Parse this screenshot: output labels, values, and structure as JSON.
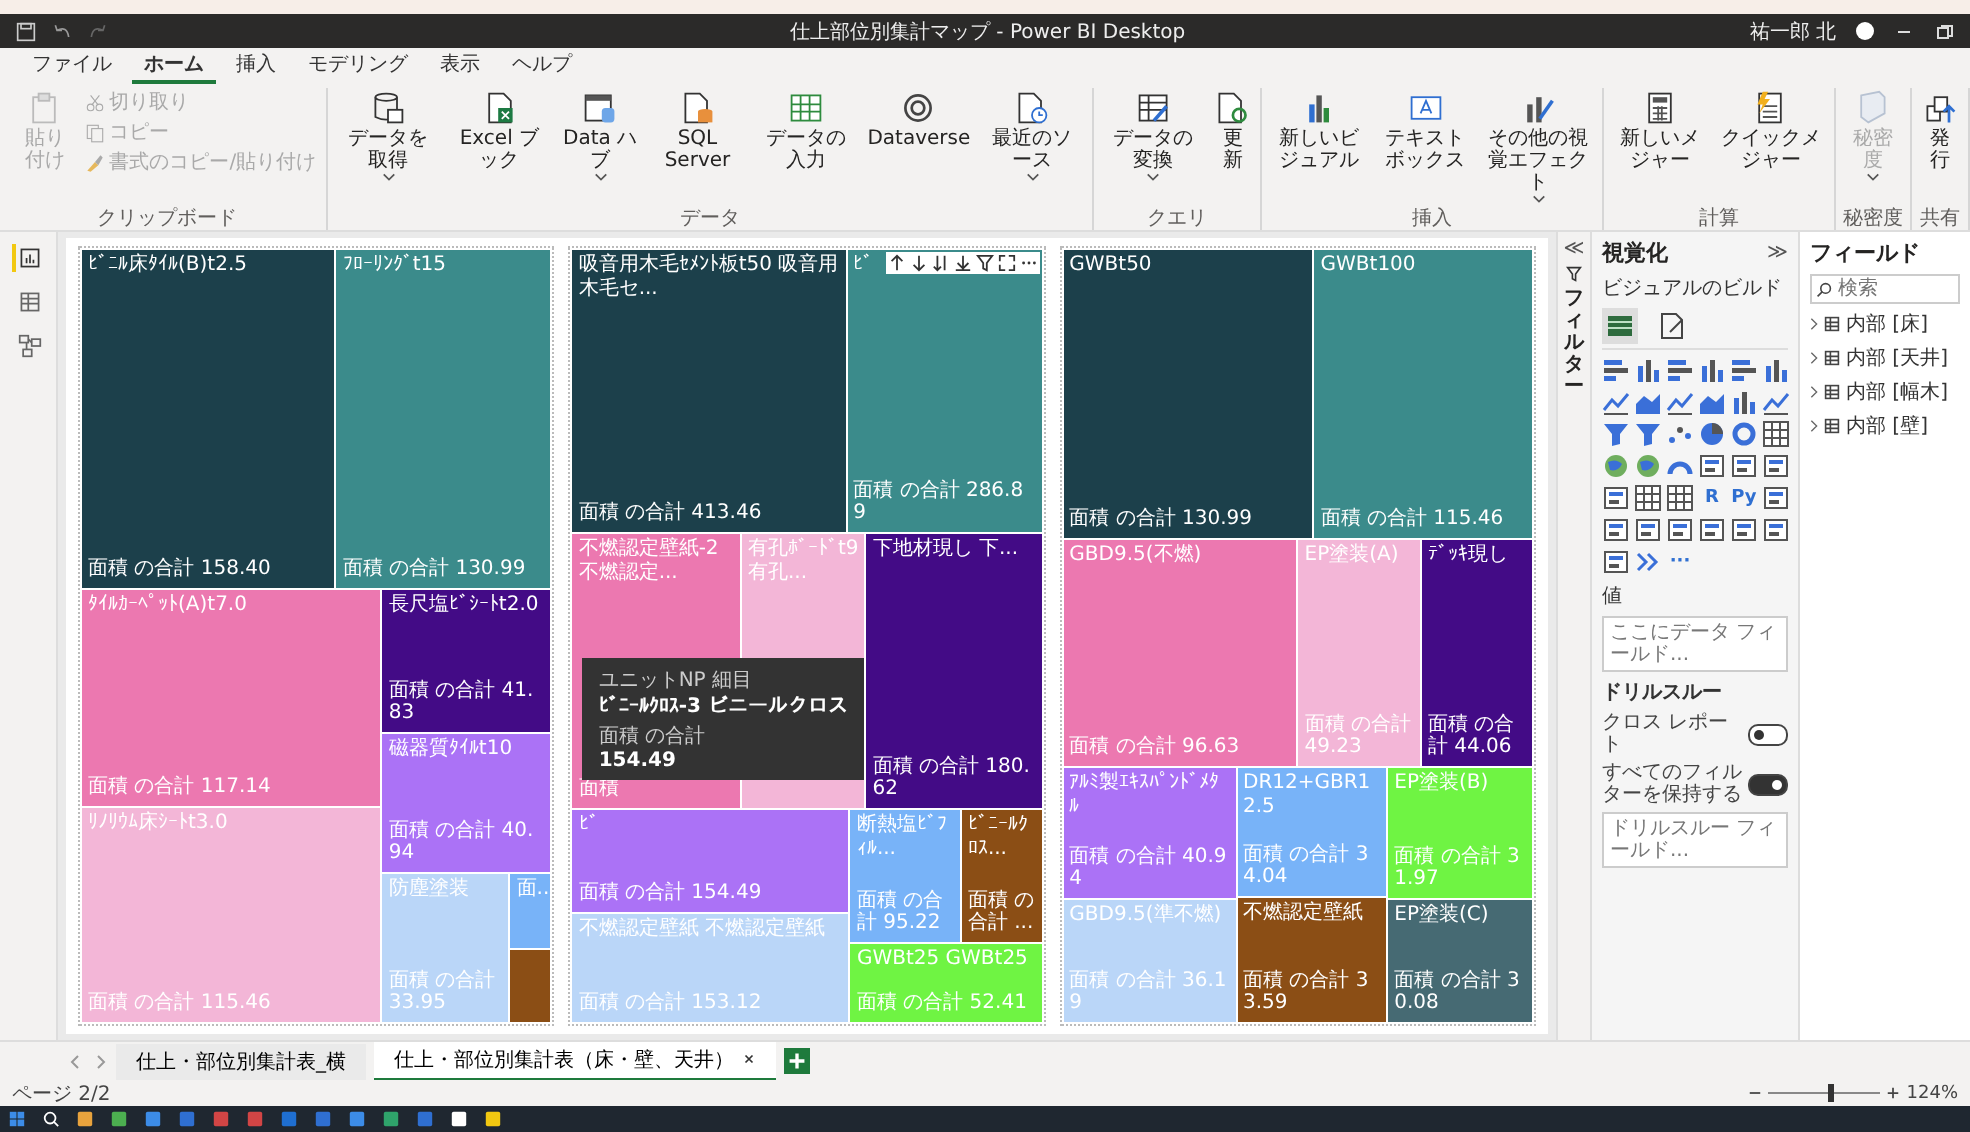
{
  "title_bar": {
    "title": "仕上部位別集計マップ - Power BI Desktop",
    "user": "祐一郎 北"
  },
  "menu_tabs": [
    {
      "label": "ファイル",
      "selected": false
    },
    {
      "label": "ホーム",
      "selected": true
    },
    {
      "label": "挿入",
      "selected": false
    },
    {
      "label": "モデリング",
      "selected": false
    },
    {
      "label": "表示",
      "selected": false
    },
    {
      "label": "ヘルプ",
      "selected": false
    }
  ],
  "ribbon": {
    "groups": [
      {
        "label": "クリップボード",
        "buttons": [
          {
            "kind": "large",
            "label": "貼り付け",
            "disabled": true,
            "dropdown": false
          },
          {
            "kind": "small",
            "label": "切り取り",
            "disabled": true
          },
          {
            "kind": "small",
            "label": "コピー",
            "disabled": true
          },
          {
            "kind": "small",
            "label": "書式のコピー/貼り付け",
            "disabled": true
          }
        ]
      },
      {
        "label": "データ",
        "buttons": [
          {
            "kind": "large",
            "label": "データを取得",
            "disabled": false,
            "dropdown": true
          },
          {
            "kind": "large",
            "label": "Excel ブック",
            "disabled": false,
            "dropdown": false
          },
          {
            "kind": "large",
            "label": "Data ハブ",
            "disabled": false,
            "dropdown": true
          },
          {
            "kind": "large",
            "label": "SQL Server",
            "disabled": false,
            "dropdown": false
          },
          {
            "kind": "large",
            "label": "データの入力",
            "disabled": false,
            "dropdown": false
          },
          {
            "kind": "large",
            "label": "Dataverse",
            "disabled": false,
            "dropdown": false
          },
          {
            "kind": "large",
            "label": "最近のソース",
            "disabled": false,
            "dropdown": true
          }
        ]
      },
      {
        "label": "クエリ",
        "buttons": [
          {
            "kind": "large",
            "label": "データの変換",
            "disabled": false,
            "dropdown": true
          },
          {
            "kind": "large",
            "label": "更新",
            "disabled": false,
            "dropdown": false
          }
        ]
      },
      {
        "label": "挿入",
        "buttons": [
          {
            "kind": "large",
            "label": "新しいビジュアル",
            "disabled": false,
            "dropdown": false
          },
          {
            "kind": "large",
            "label": "テキストボックス",
            "disabled": false,
            "dropdown": false
          },
          {
            "kind": "large",
            "label": "その他の視覚エフェクト",
            "disabled": false,
            "dropdown": true
          }
        ]
      },
      {
        "label": "計算",
        "buttons": [
          {
            "kind": "large",
            "label": "新しいメジャー",
            "disabled": false,
            "dropdown": false
          },
          {
            "kind": "large",
            "label": "クイックメジャー",
            "disabled": false,
            "dropdown": false
          }
        ]
      },
      {
        "label": "秘密度",
        "buttons": [
          {
            "kind": "large",
            "label": "秘密度",
            "disabled": true,
            "dropdown": true
          }
        ]
      },
      {
        "label": "共有",
        "buttons": [
          {
            "kind": "large",
            "label": "発行",
            "disabled": false,
            "dropdown": false
          }
        ]
      }
    ]
  },
  "left_nav": [
    {
      "selected": true
    },
    {
      "selected": false
    },
    {
      "selected": false
    }
  ],
  "visuals": [
    {
      "tiles": [
        {
          "label": "ﾋﾞﾆﾙ床ﾀｲﾙ(B)t2.5",
          "total": "面積 の合計 158.40",
          "color": "#1c404b"
        },
        {
          "label": "ﾌﾛｰﾘﾝｸﾞt15",
          "total": "面積 の合計 130.99",
          "color": "#3b8b8b"
        },
        {
          "label": "ﾀｲﾙｶｰﾍﾟｯﾄ(A)t7.0",
          "total": "面積 の合計 117.14",
          "color": "#ec78b0"
        },
        {
          "label": "ﾘﾉﾘｳﾑ床ｼｰﾄt3.0",
          "total": "面積 の合計 115.46",
          "color": "#f3b6d7"
        },
        {
          "label": "長尺塩ﾋﾞｼｰﾄt2.0",
          "total": "面積 の合計 41.83",
          "color": "#430b86"
        },
        {
          "label": "磁器質ﾀｲﾙt10",
          "total": "面積 の合計 40.94",
          "color": "#ab72f6"
        },
        {
          "label": "防塵塗装",
          "total": "面積 の合計 33.95",
          "color": "#bad6f8"
        },
        {
          "total": "面...",
          "color": "#78b3f8"
        },
        {
          "color": "#8b4e15"
        }
      ]
    },
    {
      "header": true,
      "tiles": [
        {
          "label": "吸音用木毛ｾﾒﾝﾄ板t50 吸音用木毛セ...",
          "total": "面積 の合計 413.46",
          "color": "#1c404b"
        },
        {
          "label": "ﾋﾞ",
          "total": "面積 の合計 286.89",
          "color": "#3b8b8b"
        },
        {
          "label": "不燃認定壁紙-2 不燃認定...",
          "total": "面積",
          "color": "#ec78b0"
        },
        {
          "label": "有孔ﾎﾞｰﾄﾞt9 有孔...",
          "color": "#f3b6d7"
        },
        {
          "label": "下地材現し 下...",
          "total": "面積 の合計 180.62",
          "color": "#430b86"
        },
        {
          "label": "ﾋﾞ",
          "total": "面積 の合計 154.49",
          "color": "#ab72f6"
        },
        {
          "label": "不燃認定壁紙 不燃認定壁紙",
          "total": "面積 の合計 153.12",
          "color": "#bad6f8"
        },
        {
          "label": "断熱塩ﾋﾞﾌｨﾙ...",
          "total": "面積 の合計 95.22",
          "color": "#78b3f8"
        },
        {
          "label": "ﾋﾞﾆｰﾙｸﾛｽ...",
          "total": "面積 の合計 ...",
          "color": "#8b4e15"
        },
        {
          "label": "GWBt25 GWBt25",
          "total": "面積 の合計 52.41",
          "color": "#6ff443"
        }
      ],
      "tooltip": [
        {
          "name": "ユニットNP 細目",
          "value": "ﾋﾞﾆｰﾙｸﾛｽ-3 ビニールクロス"
        },
        {
          "name": "面積 の合計",
          "value": "154.49"
        }
      ]
    },
    {
      "tiles": [
        {
          "label": "GWBt50",
          "total": "面積 の合計 130.99",
          "color": "#1c404b"
        },
        {
          "label": "GWBt100",
          "total": "面積 の合計 115.46",
          "color": "#3b8b8b"
        },
        {
          "label": "GBD9.5(不燃)",
          "total": "面積 の合計 96.63",
          "color": "#ec78b0"
        },
        {
          "label": "EP塗装(A)",
          "total": "面積 の合計 49.23",
          "color": "#f3b6d7"
        },
        {
          "label": "ﾃﾞｯｷ現し",
          "total": "面積 の合計 44.06",
          "color": "#430b86"
        },
        {
          "label": "ｱﾙﾐ製ｴｷｽﾊﾟﾝﾄﾞﾒﾀﾙ",
          "total": "面積 の合計 40.94",
          "color": "#ab72f6"
        },
        {
          "label": "GBD9.5(準不燃)",
          "total": "面積 の合計 36.19",
          "color": "#bad6f8"
        },
        {
          "label": "DR12+GBR12.5",
          "total": "面積 の合計 34.04",
          "color": "#78b3f8"
        },
        {
          "label": "不燃認定壁紙",
          "total": "面積 の合計 33.59",
          "color": "#8b4e15"
        },
        {
          "label": "EP塗装(B)",
          "total": "面積 の合計 31.97",
          "color": "#6ff443"
        },
        {
          "label": "EP塗装(C)",
          "total": "面積 の合計 30.08",
          "color": "#466a73"
        }
      ]
    }
  ],
  "filters_pane": {
    "label": "フィルター",
    "collapse": "≪"
  },
  "viz_pane": {
    "title": "視覚化",
    "expand": "≫",
    "build_label": "ビジュアルのビルド",
    "build_tabs": [
      {
        "selected": true
      },
      {
        "selected": false
      }
    ],
    "types": [
      {
        "kind": "icon"
      },
      {
        "kind": "icon"
      },
      {
        "kind": "icon"
      },
      {
        "kind": "icon"
      },
      {
        "kind": "icon"
      },
      {
        "kind": "icon"
      },
      {
        "kind": "icon"
      },
      {
        "kind": "icon"
      },
      {
        "kind": "icon"
      },
      {
        "kind": "icon"
      },
      {
        "kind": "icon"
      },
      {
        "kind": "icon"
      },
      {
        "kind": "icon"
      },
      {
        "kind": "icon"
      },
      {
        "kind": "icon"
      },
      {
        "kind": "icon"
      },
      {
        "kind": "icon"
      },
      {
        "kind": "icon"
      },
      {
        "kind": "icon"
      },
      {
        "kind": "icon"
      },
      {
        "kind": "icon"
      },
      {
        "kind": "icon"
      },
      {
        "kind": "icon"
      },
      {
        "kind": "icon"
      },
      {
        "kind": "icon"
      },
      {
        "kind": "icon"
      },
      {
        "kind": "icon"
      },
      {
        "kind": "text",
        "text": "R"
      },
      {
        "kind": "text",
        "text": "Py"
      },
      {
        "kind": "icon"
      },
      {
        "kind": "icon"
      },
      {
        "kind": "icon"
      },
      {
        "kind": "icon"
      },
      {
        "kind": "icon"
      },
      {
        "kind": "icon"
      },
      {
        "kind": "icon"
      },
      {
        "kind": "icon"
      },
      {
        "kind": "icon"
      },
      {
        "kind": "text",
        "text": "···"
      }
    ],
    "values_label": "値",
    "values_placeholder": "ここにデータ フィールド...",
    "drill_label": "ドリルスルー",
    "toggles": [
      {
        "label": "クロス レポート",
        "on": false
      },
      {
        "label": "すべてのフィルターを保持する",
        "on": true
      }
    ],
    "drill_placeholder": "ドリルスルー フィールド..."
  },
  "fields_pane": {
    "title": "フィールド",
    "search_placeholder": "検索",
    "tables": [
      {
        "name": "内部 [床]",
        "expanded": false
      },
      {
        "name": "内部 [天井]",
        "expanded": false
      },
      {
        "name": "内部 [幅木]",
        "expanded": false
      },
      {
        "name": "内部 [壁]",
        "expanded": false
      }
    ]
  },
  "page_tabs": [
    {
      "label": "仕上・部位別集計表_横",
      "selected": false
    },
    {
      "label": "仕上・部位別集計表（床・壁、天井）",
      "selected": true
    }
  ],
  "status_bar": {
    "page": "ページ 2/2",
    "zoom": {
      "level": 0.55,
      "reading": "124%"
    }
  }
}
